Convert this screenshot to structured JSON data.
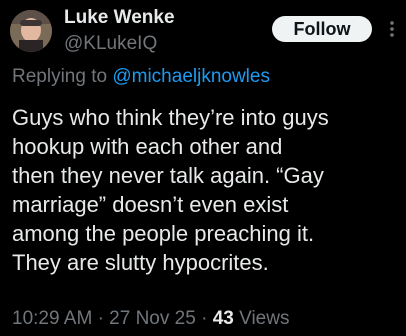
{
  "author": {
    "name": "Luke Wenke",
    "handle": "@KLukeIQ"
  },
  "follow_label": "Follow",
  "more_icon": "more-vertical-icon",
  "reply": {
    "prefix": "Replying to",
    "mention": "@michaeljknowles"
  },
  "tweet_lines": [
    "Guys who think they’re into guys",
    "hookup with each other and",
    "then they never talk again.  “Gay",
    "marriage” doesn’t even exist",
    "among the people preaching it.",
    "They are slutty hypocrites."
  ],
  "meta": {
    "time": "10:29 AM",
    "sep1": "·",
    "date": "27 Nov 25",
    "sep2": "·",
    "views_count": "43",
    "views_label": "Views"
  },
  "colors": {
    "background": "#000000",
    "text": "#e7e9ea",
    "secondary": "#71767b",
    "link": "#1d9bf0",
    "button_bg": "#eff3f4"
  }
}
